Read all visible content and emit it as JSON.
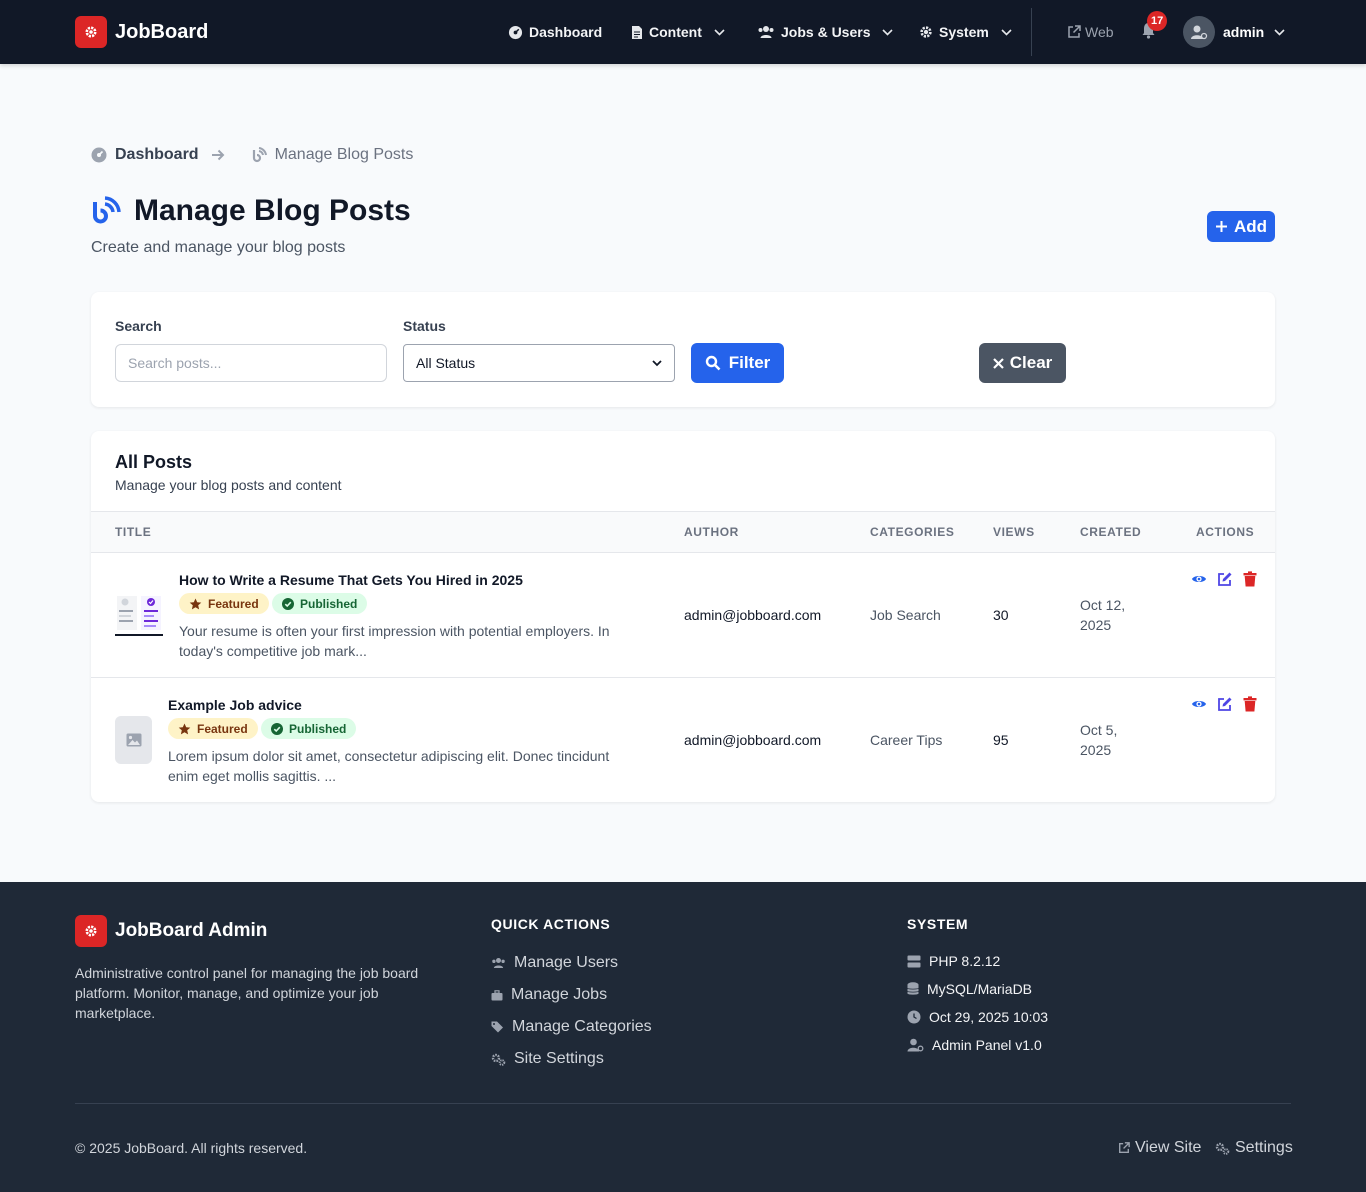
{
  "brand": {
    "name": "JobBoard",
    "color": "#dc2626"
  },
  "nav": {
    "items": [
      {
        "label": "Dashboard",
        "icon": "gauge-icon"
      },
      {
        "label": "Content",
        "icon": "document-icon"
      },
      {
        "label": "Jobs & Users",
        "icon": "users-icon"
      },
      {
        "label": "System",
        "icon": "gear-icon"
      }
    ],
    "web_label": "Web",
    "notification_count": "17",
    "user_name": "admin"
  },
  "breadcrumb": {
    "home": "Dashboard",
    "current": "Manage Blog Posts"
  },
  "page": {
    "title": "Manage Blog Posts",
    "subtitle": "Create and manage your blog posts",
    "add_label": "Add",
    "accent": "#2563eb"
  },
  "filters": {
    "search_label": "Search",
    "search_placeholder": "Search posts...",
    "status_label": "Status",
    "status_value": "All Status",
    "filter_label": "Filter",
    "clear_label": "Clear"
  },
  "table": {
    "title": "All Posts",
    "subtitle": "Manage your blog posts and content",
    "columns": [
      "Title",
      "Author",
      "Categories",
      "Views",
      "Created",
      "Actions"
    ],
    "rows": [
      {
        "title": "How to Write a Resume That Gets You Hired in 2025",
        "featured": "Featured",
        "status": "Published",
        "excerpt": "Your resume is often your first impression with potential employers. In today's competitive job mark...",
        "author": "admin@jobboard.com",
        "category": "Job Search",
        "views": "30",
        "created": "Oct 12, 2025"
      },
      {
        "title": "Example Job advice",
        "featured": "Featured",
        "status": "Published",
        "excerpt": "Lorem ipsum dolor sit amet, consectetur adipiscing elit. Donec tincidunt enim eget mollis sagittis. ...",
        "author": "admin@jobboard.com",
        "category": "Career Tips",
        "views": "95",
        "created": "Oct 5, 2025"
      }
    ]
  },
  "footer": {
    "brand": "JobBoard Admin",
    "description": "Administrative control panel for managing the job board platform. Monitor, manage, and optimize your job marketplace.",
    "quick_actions_title": "Quick Actions",
    "quick_actions": [
      "Manage Users",
      "Manage Jobs",
      "Manage Categories",
      "Site Settings"
    ],
    "system_title": "System",
    "system": [
      "PHP 8.2.12",
      "MySQL/MariaDB",
      "Oct 29, 2025 10:03",
      "Admin Panel v1.0"
    ],
    "copyright": "© 2025 JobBoard. All rights reserved.",
    "view_site": "View Site",
    "settings": "Settings"
  }
}
